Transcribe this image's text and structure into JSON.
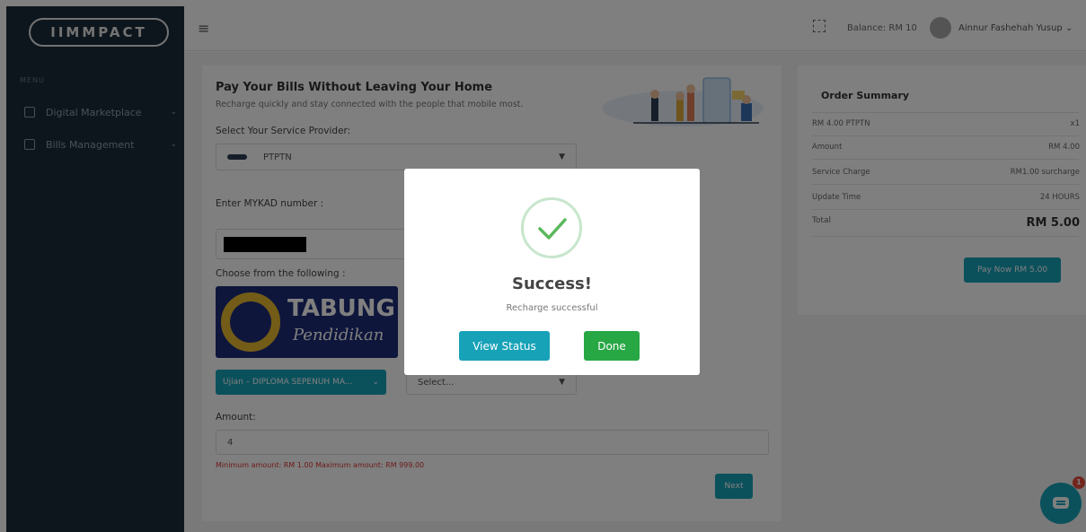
{
  "app": {
    "logo_text": "IIMMPACT"
  },
  "sidebar": {
    "menu_label": "MENU",
    "items": [
      {
        "label": "Digital Marketplace",
        "icon": "phone-icon"
      },
      {
        "label": "Bills Management",
        "icon": "document-icon"
      }
    ]
  },
  "topbar": {
    "balance": "Balance: RM 10",
    "user_name": "Ainnur Fashehah Yusup"
  },
  "form": {
    "title": "Pay Your Bills Without Leaving Your Home",
    "subtitle": "Recharge quickly and stay connected with the people that mobile most.",
    "provider_label": "Select Your Service Provider:",
    "provider_value": "PTPTN",
    "mykad_label": "Enter MYKAD number :",
    "choose_label": "Choose from the following :",
    "logo_main": "TABUNG",
    "logo_sub": "Pendidikan",
    "ujian_value": "Ujian – DIPLOMA SEPENUH MA...",
    "select_placeholder": "Select...",
    "amount_label": "Amount:",
    "amount_value": "4",
    "amount_hint": "Minimum amount: RM 1.00 Maximum amount: RM 999.00",
    "next_label": "Next"
  },
  "order_summary": {
    "title": "Order Summary",
    "rows": [
      {
        "label": "RM 4.00 PTPTN",
        "value": "x1"
      },
      {
        "label": "Amount",
        "value": "RM 4.00"
      },
      {
        "label": "Service Charge",
        "value": "RM1.00 surcharge"
      },
      {
        "label": "Update Time",
        "value": "24 HOURS"
      }
    ],
    "total_label": "Total",
    "total_value": "RM 5.00",
    "pay_label": "Pay Now RM 5.00"
  },
  "modal": {
    "title": "Success!",
    "message": "Recharge successful",
    "view_status_label": "View Status",
    "done_label": "Done"
  },
  "chat": {
    "badge": "1"
  },
  "colors": {
    "accent": "#17a2b8",
    "success": "#28a745",
    "sidebar": "#1d2c3b"
  }
}
